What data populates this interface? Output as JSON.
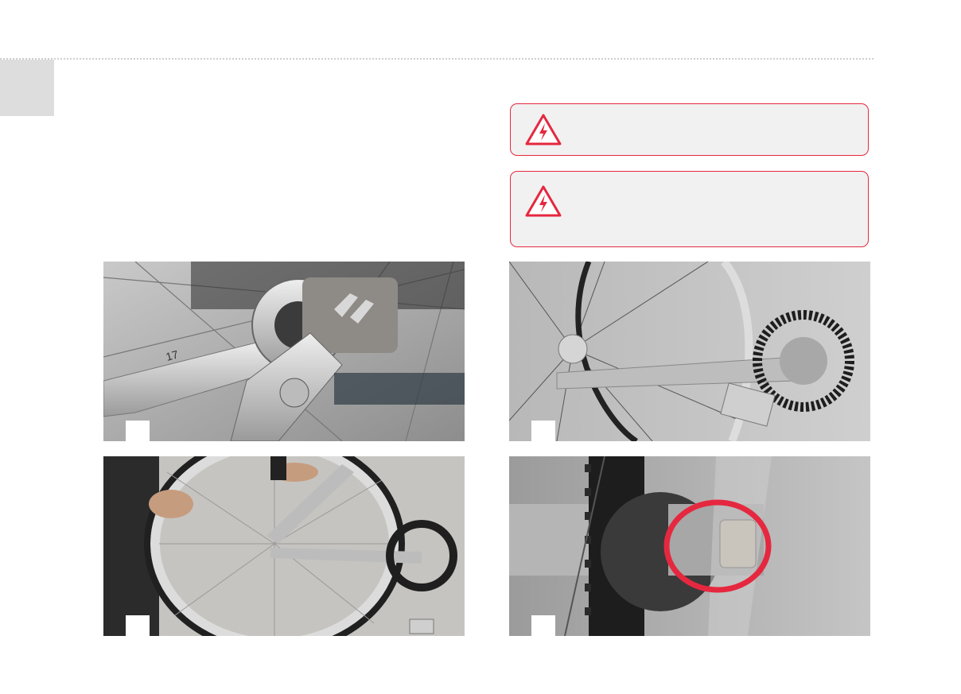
{
  "page": {
    "corner_tab_text": ""
  },
  "warnings": [
    {
      "icon": "electric-hazard-icon",
      "text": ""
    },
    {
      "icon": "electric-hazard-icon",
      "text": ""
    }
  ],
  "photos": [
    {
      "subject": "wrench-on-rear-axle-nut",
      "step_label": ""
    },
    {
      "subject": "rear-wheel-belt-drive",
      "step_label": ""
    },
    {
      "subject": "hands-removing-rear-wheel",
      "step_label": ""
    },
    {
      "subject": "rear-hub-spacer-highlighted",
      "step_label": ""
    }
  ],
  "colors": {
    "accent_red": "#e5283f",
    "warning_background": "#f1f1f1",
    "tab_gray": "#dddddd"
  }
}
